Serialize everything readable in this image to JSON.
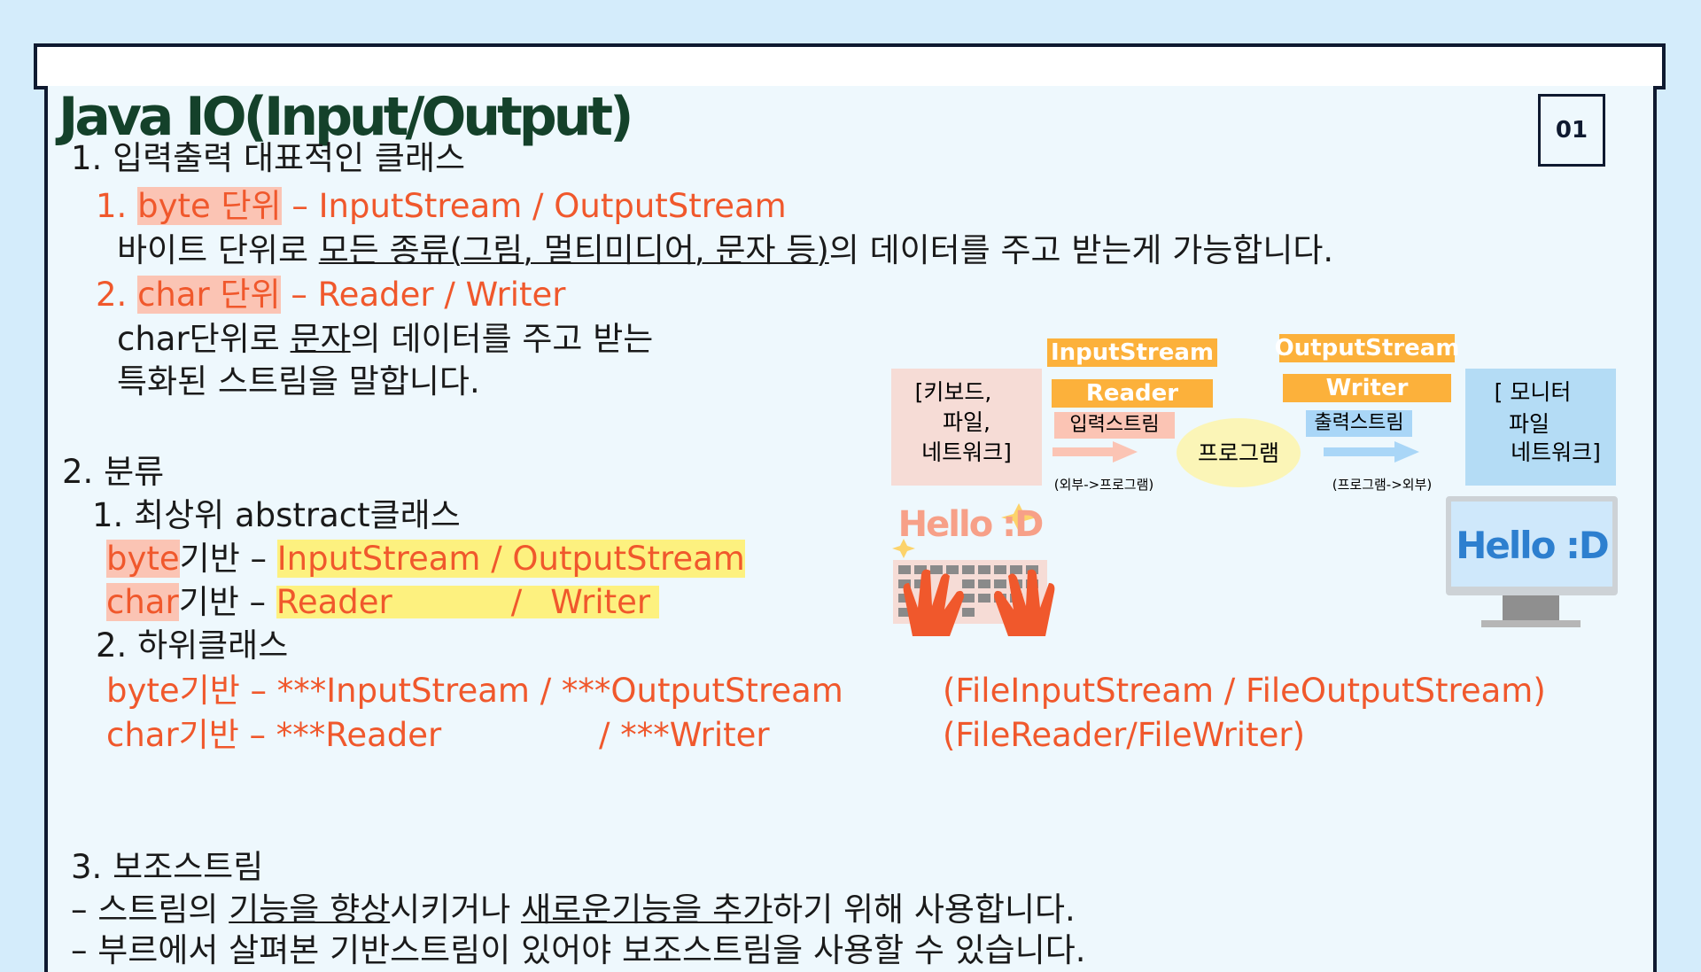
{
  "title": "Java IO(Input/Output)",
  "page_number": "01",
  "colors": {
    "accent_orange": "#f0582c",
    "title_green": "#14412a",
    "highlight_yellow": "#fdf17f",
    "highlight_pink": "#fbc4b4",
    "background": "#d4ecfb"
  },
  "s1": {
    "heading": "1. 입력출력 대표적인 클래스",
    "i1_num": "1.",
    "i1_label": "byte 단위",
    "i1_sep": "–",
    "i1_classes": "InputStream / OutputStream",
    "i1_d1": "바이트 단위로 ",
    "i1_d2": "모든 종류(그림, 멀티미디어, 문자 등)",
    "i1_d3": "의 데이터를 주고 받는게 가능합니다.",
    "i2_num": "2.",
    "i2_label": "char 단위",
    "i2_sep": "–",
    "i2_classes": "Reader / Writer",
    "i2_d1": "char단위로 ",
    "i2_d2": "문자",
    "i2_d3": "의 데이터를 주고 받는",
    "i2_d4": "특화된 스트림을 말합니다."
  },
  "s2": {
    "heading": "2. 분류",
    "sub1": "1. 최상위 abstract클래스",
    "b_label": "byte",
    "b_rest": "기반 – ",
    "b_classes": "InputStream / OutputStream",
    "c_label": "char",
    "c_rest": "기반 – ",
    "c_reader": "Reader",
    "c_slash": "/",
    "c_writer": "Writer",
    "sub2": "2. 하위클래스",
    "r1_a": "byte기반 – ***InputStream / ***OutputStream",
    "r1_b": "(FileInputStream / FileOutputStream)",
    "r2_a": "char기반 – ***Reader",
    "r2_b": "/ ***Writer",
    "r2_c": "(FileReader/FileWriter)"
  },
  "s3": {
    "heading": "3. 보조스트림",
    "l1_a": "– 스트림의 ",
    "l1_b": "기능을 향상",
    "l1_c": "시키거나 ",
    "l1_d": "새로운기능을 추가",
    "l1_e": "하기 위해 사용합니다.",
    "l2": "– 부르에서 살펴본 기반스트림이 있어야 보조스트림을 사용할 수 있습니다."
  },
  "diagram": {
    "source_lines": [
      "[키보드,",
      "파일,",
      "네트워크]"
    ],
    "input_stream": "InputStream",
    "reader": "Reader",
    "input_label": "입력스트림",
    "input_dir": "(외부->프로그램)",
    "program": "프로그램",
    "output_stream": "OutputStream",
    "writer": "Writer",
    "output_label": "출력스트림",
    "output_dir": "(프로그램->외부)",
    "dest_lines": [
      "[ 모니터",
      "파일",
      "네트워크]"
    ],
    "keyboard_text": "Hello :D",
    "monitor_text": "Hello :D"
  }
}
